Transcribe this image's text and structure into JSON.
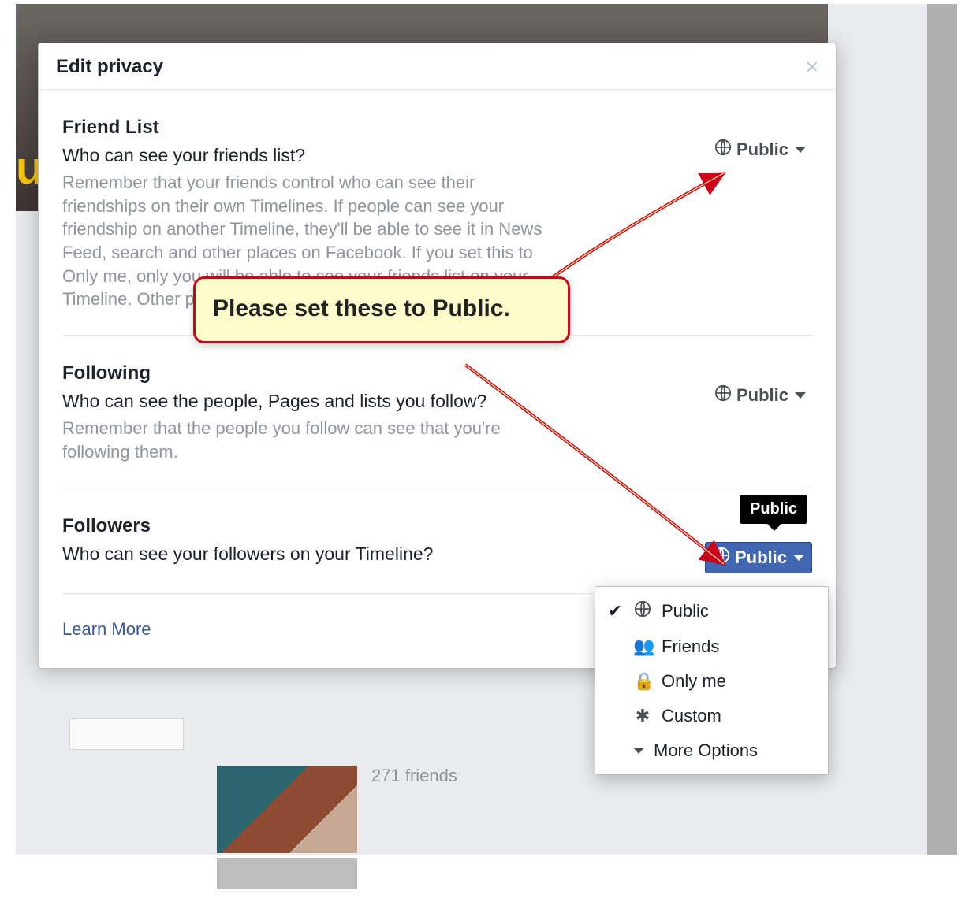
{
  "modal": {
    "title": "Edit privacy",
    "close_glyph": "×",
    "learn_more": "Learn More"
  },
  "sections": {
    "friend_list": {
      "heading": "Friend List",
      "question": "Who can see your friends list?",
      "description": "Remember that your friends control who can see their friendships on their own Timelines. If people can see your friendship on another Timeline, they'll be able to see it in News Feed, search and other places on Facebook. If you set this to Only me, only you will be able to see your friends list on your Timeline. Other people will see only mutual friends.",
      "current_value": "Public"
    },
    "following": {
      "heading": "Following",
      "question": "Who can see the people, Pages and lists you follow?",
      "description": "Remember that the people you follow can see that you're following them.",
      "current_value": "Public"
    },
    "followers": {
      "heading": "Followers",
      "question": "Who can see your followers on your Timeline?",
      "tooltip": "Public",
      "current_value": "Public"
    }
  },
  "dropdown": {
    "options": {
      "public": "Public",
      "friends": "Friends",
      "only_me": "Only me",
      "custom": "Custom",
      "more_options": "More Options"
    },
    "selected": "Public"
  },
  "callout": {
    "text": "Please set these to Public."
  },
  "background": {
    "friend_count_text": "271 friends"
  }
}
